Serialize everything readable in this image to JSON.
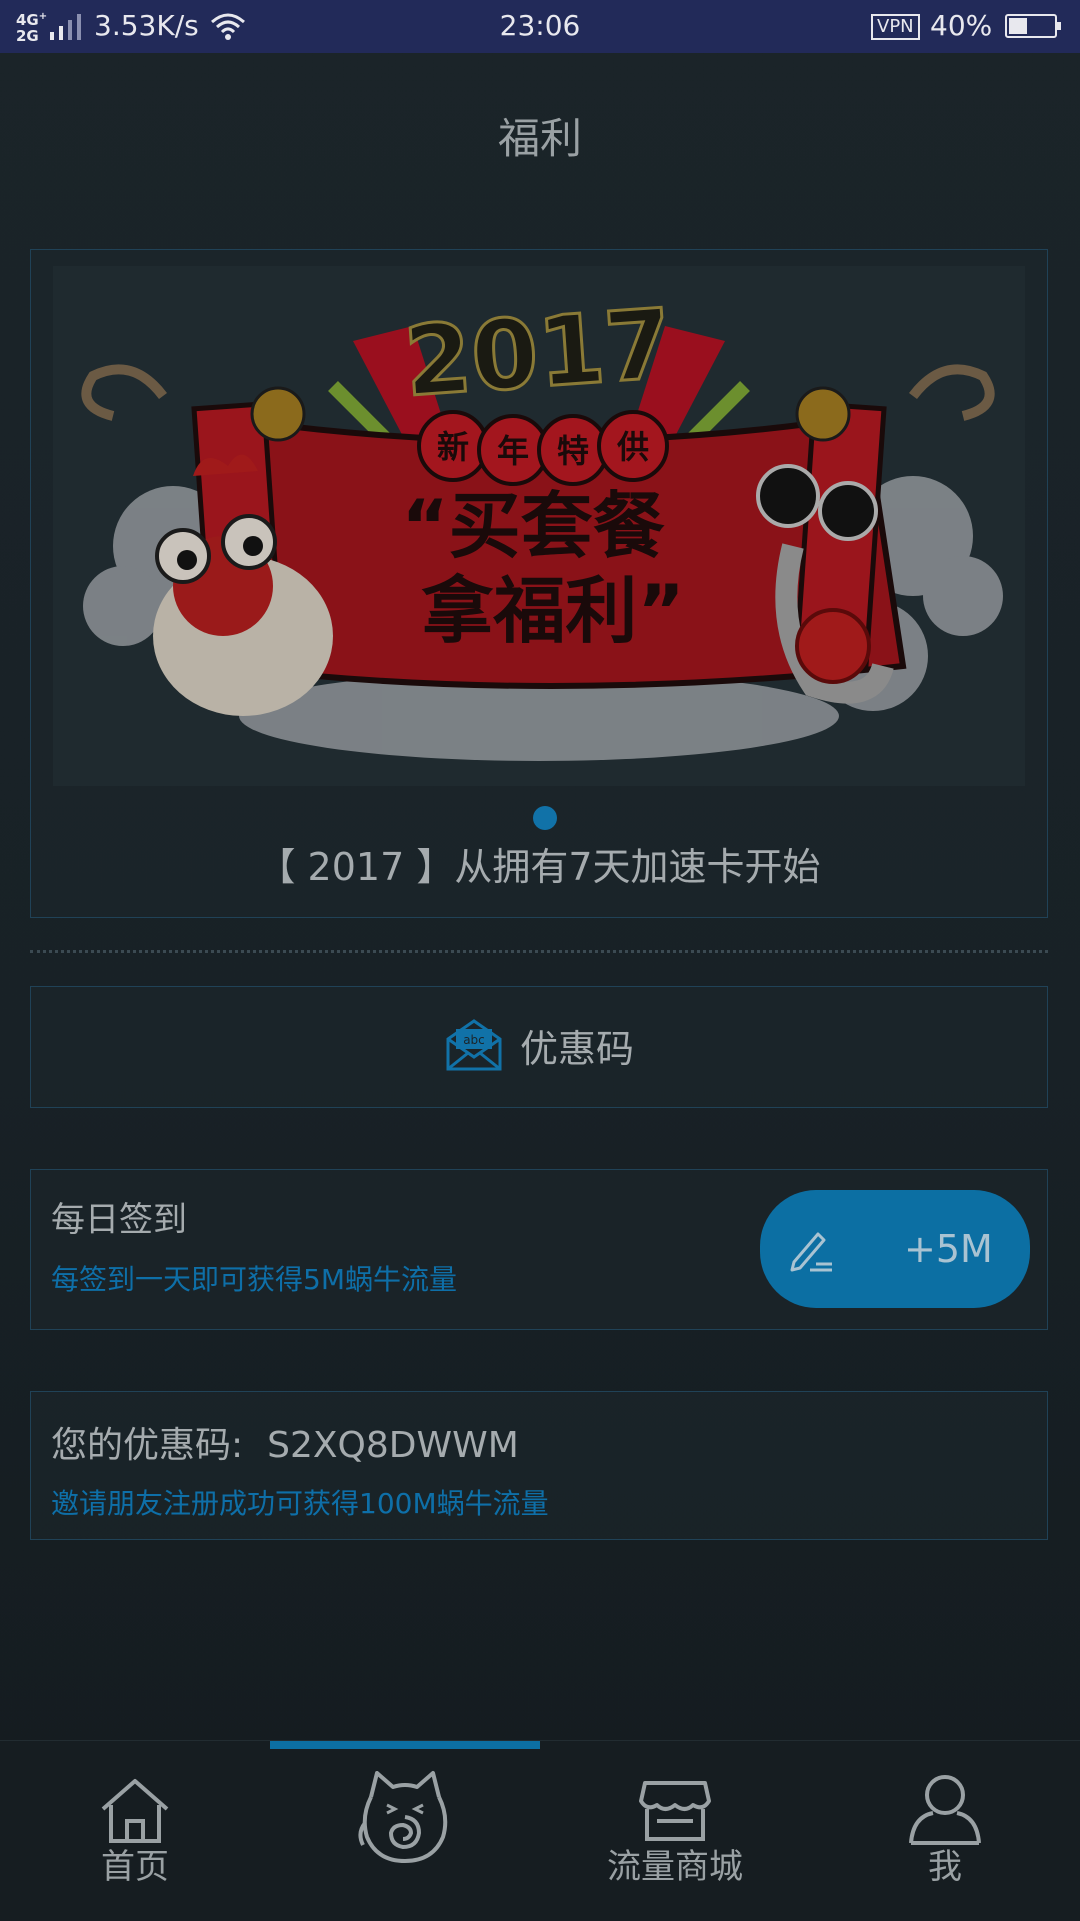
{
  "status_bar": {
    "network": "4G+\n2G",
    "speed": "3.53K/s",
    "time": "23:06",
    "vpn": "VPN",
    "battery_percent": "40%",
    "battery_level": 0.4
  },
  "header": {
    "title": "福利"
  },
  "banner": {
    "image": "2017 新年特供 买套餐拿福利 promotional banner",
    "caption": "【 2017 】从拥有7天加速卡开始",
    "active_index": 0,
    "total_slides": 1
  },
  "promo_code_entry": {
    "icon": "envelope-abc-icon",
    "label": "优惠码"
  },
  "daily_checkin": {
    "title": "每日签到",
    "description": "每签到一天即可获得5M蜗牛流量",
    "button_label": "+5M",
    "button_icon": "pen-sign-icon"
  },
  "invite": {
    "label": "您的优惠码:",
    "code": "S2XQ8DWWM",
    "description": "邀请朋友注册成功可获得100M蜗牛流量"
  },
  "tabs": [
    {
      "label": "首页",
      "icon": "home-icon"
    },
    {
      "label": "",
      "icon": "snail-cat-icon",
      "active": true
    },
    {
      "label": "流量商城",
      "icon": "store-icon"
    },
    {
      "label": "我",
      "icon": "person-icon"
    }
  ],
  "colors": {
    "accent": "#0c6fa3",
    "status_bar": "#222a59",
    "link_text": "#0e6fa8"
  }
}
